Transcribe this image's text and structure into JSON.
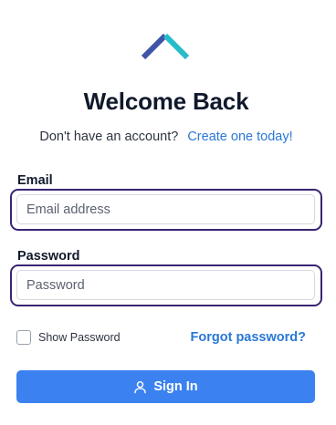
{
  "brand": {
    "logo_icon": "chevron-up-logo",
    "colors": {
      "logo_left": "#3f55a8",
      "logo_right": "#27bcc9",
      "accent": "#2a78d6",
      "button": "#3b82f0",
      "focus_ring": "#3a2472"
    }
  },
  "header": {
    "title": "Welcome Back",
    "subtitle_text": "Don't have an account?",
    "subtitle_link": "Create one today!"
  },
  "form": {
    "email": {
      "label": "Email",
      "placeholder": "Email address",
      "value": ""
    },
    "password": {
      "label": "Password",
      "placeholder": "Password",
      "value": ""
    },
    "show_password": {
      "label": "Show Password",
      "checked": false
    },
    "forgot_link": "Forgot password?",
    "submit": {
      "label": "Sign In",
      "icon": "user-icon"
    }
  }
}
